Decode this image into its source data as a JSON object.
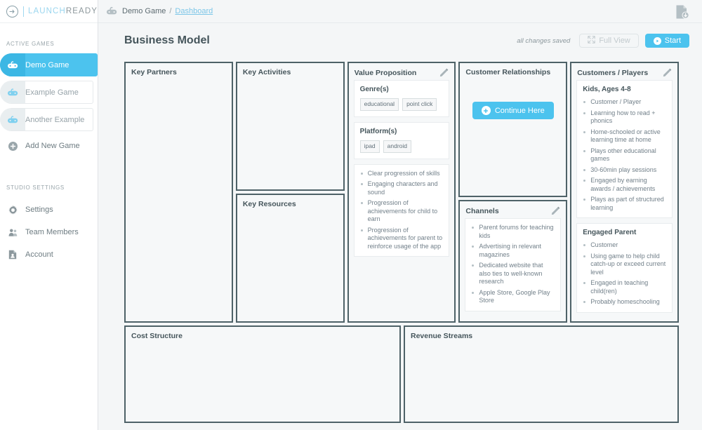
{
  "brand": {
    "name_part_1": "LAUNCH",
    "name_part_2": "READY",
    "accent_color": "#4cc3ee",
    "panel_border_color": "#4e6268"
  },
  "sidebar": {
    "active_games_label": "ACTIVE GAMES",
    "games": [
      {
        "label": "Demo Game",
        "active": true
      },
      {
        "label": "Example Game",
        "active": false
      },
      {
        "label": "Another Example",
        "active": false
      }
    ],
    "add_new_game_label": "Add New Game",
    "studio_settings_label": "STUDIO SETTINGS",
    "settings": [
      {
        "label": "Settings",
        "icon": "gear-icon"
      },
      {
        "label": "Team Members",
        "icon": "team-icon"
      },
      {
        "label": "Account",
        "icon": "account-document-icon"
      }
    ]
  },
  "topbar": {
    "breadcrumb_game": "Demo Game",
    "breadcrumb_separator": "/",
    "breadcrumb_link": "Dashboard",
    "export_icon": "document-download-icon"
  },
  "header": {
    "title": "Business Model",
    "saved_note": "all changes saved",
    "full_view_label": "Full View",
    "start_label": "Start"
  },
  "canvas": {
    "key_partners": {
      "title": "Key Partners"
    },
    "key_activities": {
      "title": "Key Activities"
    },
    "key_resources": {
      "title": "Key Resources"
    },
    "value_proposition": {
      "title": "Value Proposition",
      "genres_title": "Genre(s)",
      "genres": [
        "educational",
        "point click"
      ],
      "platforms_title": "Platform(s)",
      "platforms": [
        "ipad",
        "android"
      ],
      "bullets": [
        "Clear progression of skills",
        "Engaging characters and sound",
        "Progression of achievements for child to earn",
        "Progression of achievements for parent to reinforce usage of the app"
      ]
    },
    "customer_relationships": {
      "title": "Customer Relationships",
      "continue_label": "Continue Here"
    },
    "channels": {
      "title": "Channels",
      "bullets": [
        "Parent forums for teaching kids",
        "Advertising in relevant magazines",
        "Dedicated website that also ties to well-known research",
        "Apple Store, Google Play Store"
      ]
    },
    "customers_players": {
      "title": "Customers / Players",
      "segment_1_title": "Kids, Ages 4-8",
      "segment_1_bullets": [
        "Customer / Player",
        "Learning how to read + phonics",
        "Home-schooled or active learning time at home",
        "Plays other educational games",
        "30-60min play sessions",
        "Engaged by earning awards / achievements",
        "Plays as part of structured learning"
      ],
      "segment_2_title": "Engaged Parent",
      "segment_2_bullets": [
        "Customer",
        "Using game to help child catch-up or exceed current level",
        "Engaged in teaching child(ren)",
        "Probably homeschooling"
      ]
    },
    "cost_structure": {
      "title": "Cost Structure"
    },
    "revenue_streams": {
      "title": "Revenue Streams"
    }
  }
}
